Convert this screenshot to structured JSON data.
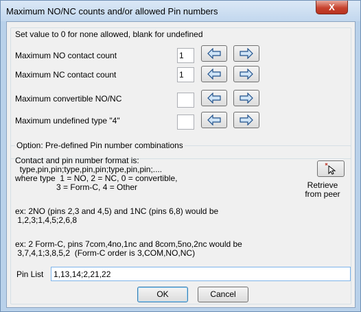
{
  "window": {
    "title": "Maximum NO/NC counts and/or allowed Pin numbers",
    "close_glyph": "X"
  },
  "top": {
    "hint": "Set value to 0 for none allowed, blank for undefined",
    "rows": [
      {
        "label": "Maximum NO contact count",
        "value": "1"
      },
      {
        "label": "Maximum NC contact count",
        "value": "1"
      },
      {
        "label": "Maximum convertible NO/NC",
        "value": ""
      },
      {
        "label": "Maximum undefined type \"4\"",
        "value": ""
      }
    ]
  },
  "options": {
    "group_title": "Option: Pre-defined Pin number combinations",
    "format_text": "Contact and pin number format is:\n  type,pin,pin;type,pin,pin;type,pin,pin;....\nwhere type  1 = NO, 2 = NC, 0 = convertible,\n                  3 = Form-C, 4 = Other",
    "retrieve_label": "Retrieve\nfrom peer",
    "example1": "ex: 2NO (pins 2,3 and 4,5) and 1NC (pins 6,8) would be\n 1,2,3;1,4,5;2,6,8",
    "example2": "ex: 2 Form-C, pins 7com,4no,1nc and 8com,5no,2nc would be\n 3,7,4,1;3,8,5,2  (Form-C order is 3,COM,NO,NC)",
    "pin_list_label": "Pin List",
    "pin_list_value": "1,13,14;2,21,22"
  },
  "buttons": {
    "ok": "OK",
    "cancel": "Cancel"
  }
}
